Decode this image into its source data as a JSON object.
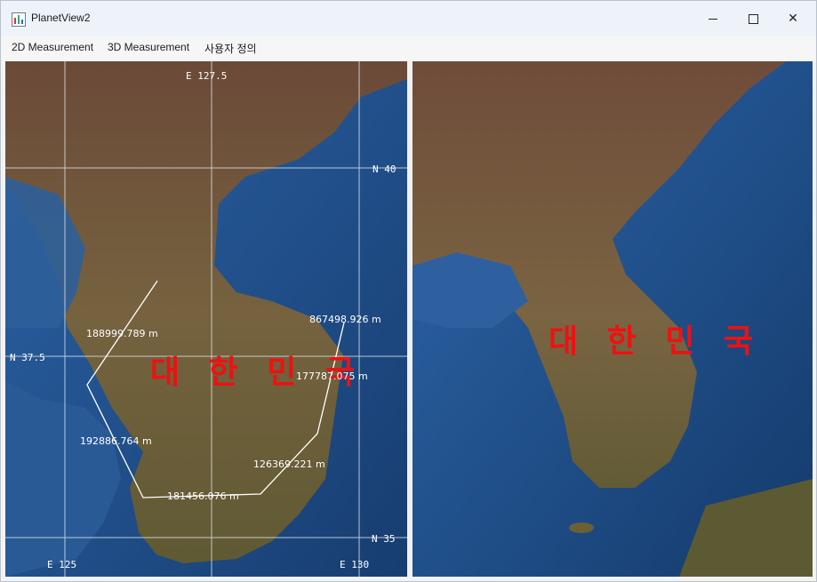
{
  "window": {
    "title": "PlanetView2"
  },
  "menu": [
    "2D Measurement",
    "3D Measurement",
    "사용자 정의"
  ],
  "left_map": {
    "coord_labels": {
      "e1275": "E 127.5",
      "n40": "N 40",
      "n375": "N 37.5",
      "n35": "N 35",
      "e125": "E 125",
      "e130": "E 130"
    },
    "region_label": "대 한 민 국",
    "distances": [
      "188999.789 m",
      "192886.764 m",
      "181456.076 m",
      "126369.221 m",
      "177787.075 m",
      "867498.926 m"
    ]
  },
  "right_map": {
    "region_label": "대 한 민 국"
  },
  "colors": {
    "label_red": "#ee1111",
    "grid": "#d8dde6",
    "ocean": "#1f4f8a",
    "land": "#6f5a3a"
  }
}
